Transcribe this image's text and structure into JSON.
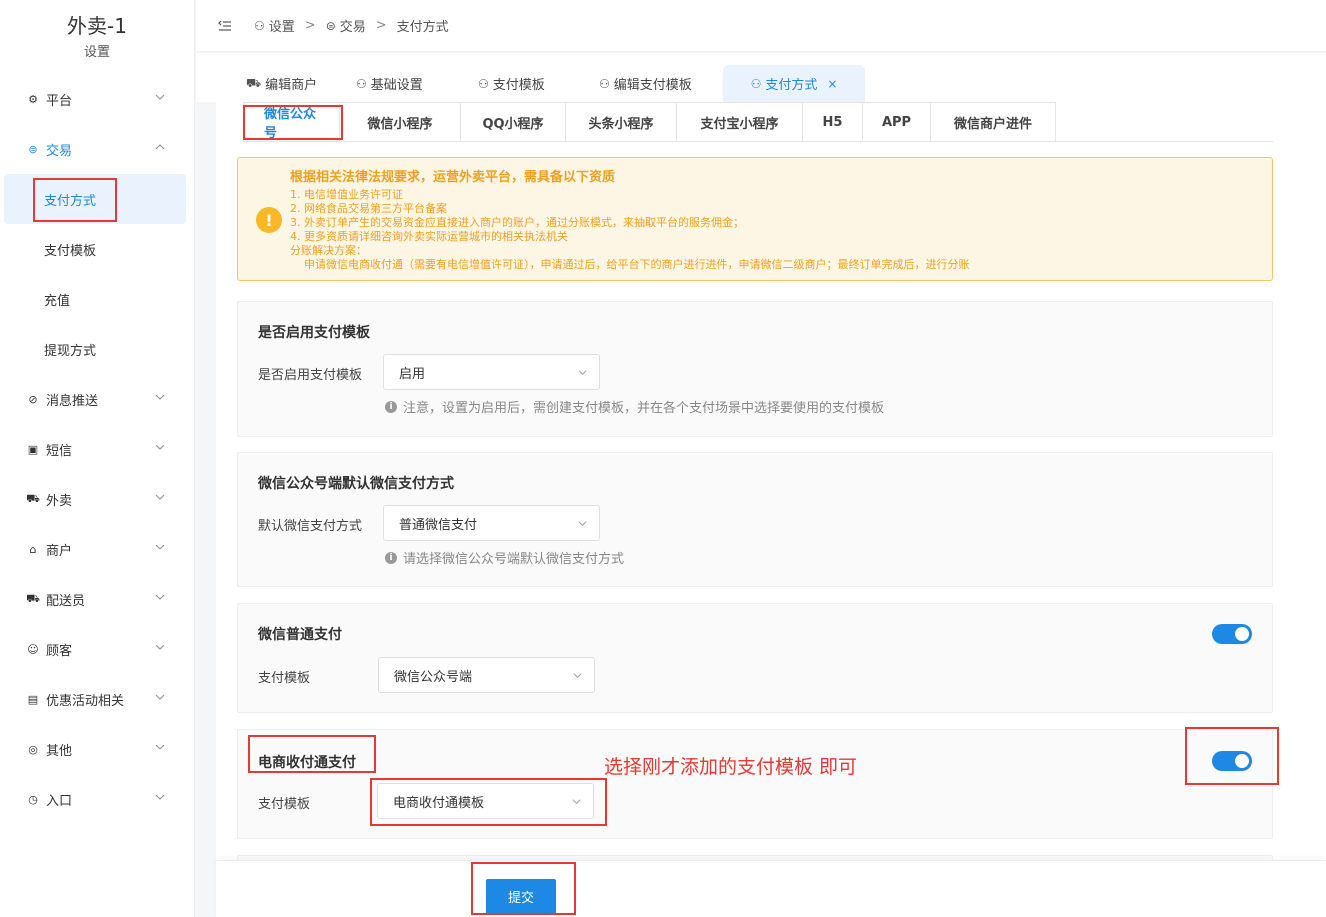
{
  "brand": {
    "name": "外卖-1",
    "sub": "设置"
  },
  "sidebar": {
    "items": [
      {
        "label": "平台",
        "icon": "gear-icon"
      },
      {
        "label": "交易",
        "icon": "trade-icon"
      },
      {
        "label": "消息推送",
        "icon": "message-icon"
      },
      {
        "label": "短信",
        "icon": "sms-icon"
      },
      {
        "label": "外卖",
        "icon": "delivery-icon"
      },
      {
        "label": "商户",
        "icon": "store-icon"
      },
      {
        "label": "配送员",
        "icon": "courier-icon"
      },
      {
        "label": "顾客",
        "icon": "user-icon"
      },
      {
        "label": "优惠活动相关",
        "icon": "gift-icon"
      },
      {
        "label": "其他",
        "icon": "other-icon"
      },
      {
        "label": "入口",
        "icon": "entry-icon"
      }
    ],
    "sub_items": [
      "支付方式",
      "支付模板",
      "充值",
      "提现方式"
    ]
  },
  "breadcrumb": [
    "设置",
    "交易",
    "支付方式"
  ],
  "page_tabs": [
    "编辑商户",
    "基础设置",
    "支付模板",
    "编辑支付模板",
    "支付方式"
  ],
  "page_tab_close": "×",
  "sub_tabs": [
    "微信公众号",
    "微信小程序",
    "QQ小程序",
    "头条小程序",
    "支付宝小程序",
    "H5",
    "APP",
    "微信商户进件"
  ],
  "notice": {
    "title": "根据相关法律法规要求，运营外卖平台，需具备以下资质",
    "lines": [
      "1. 电信增值业务许可证",
      "2. 网络食品交易第三方平台备案",
      "3. 外卖订单产生的交易资金应直接进入商户的账户，通过分账模式，来抽取平台的服务佣金；",
      "4. 更多资质请详细咨询外卖实际运营城市的相关执法机关",
      "分账解决方案：",
      "申请微信电商收付通（需要有电信增值许可证），申请通过后，给平台下的商户进行进件，申请微信二级商户；最终订单完成后，进行分账"
    ]
  },
  "sections": {
    "template_enable": {
      "title": "是否启用支付模板",
      "label": "是否启用支付模板",
      "value": "启用",
      "hint": "注意，设置为启用后，需创建支付模板，并在各个支付场景中选择要使用的支付模板"
    },
    "default_method": {
      "title": "微信公众号端默认微信支付方式",
      "label": "默认微信支付方式",
      "value": "普通微信支付",
      "hint": "请选择微信公众号端默认微信支付方式"
    },
    "normal_pay": {
      "title": "微信普通支付",
      "label": "支付模板",
      "value": "微信公众号端",
      "enabled": true
    },
    "ecommerce_pay": {
      "title": "电商收付通支付",
      "label": "支付模板",
      "value": "电商收付通模板",
      "enabled": true
    }
  },
  "annotation": "选择刚才添加的支付模板 即可",
  "submit_label": "提交",
  "colors": {
    "primary": "#1e88e5",
    "warning": "#f0a020",
    "annotation": "#e53935"
  }
}
